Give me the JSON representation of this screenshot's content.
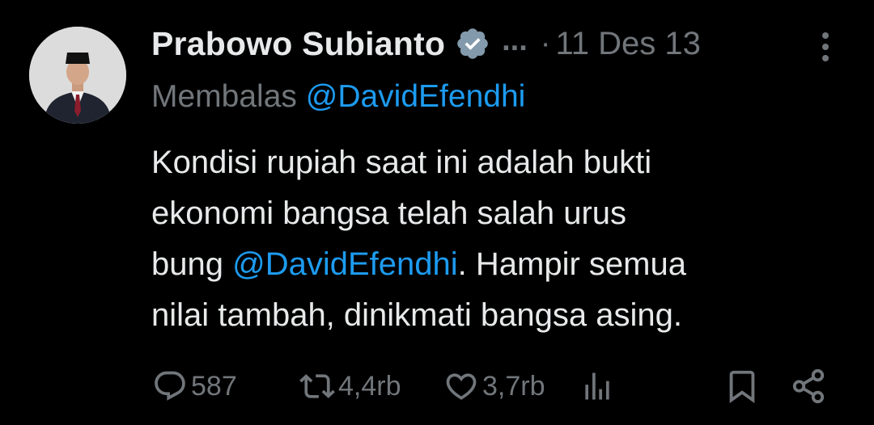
{
  "author": {
    "name": "Prabowo Subianto",
    "ellipsis": "...",
    "separator": "·",
    "date": "11 Des 13"
  },
  "reply": {
    "prefix": "Membalas ",
    "mention": "@DavidEfendhi"
  },
  "tweet": {
    "line1": "Kondisi rupiah saat ini adalah bukti",
    "line2": "ekonomi bangsa telah salah urus",
    "line3_prefix": "bung ",
    "line3_mention": "@DavidEfendhi",
    "line3_suffix": ". Hampir semua",
    "line4": "nilai tambah, dinikmati bangsa asing."
  },
  "actions": {
    "reply_icon": "reply-icon",
    "reply_count": "587",
    "retweet_icon": "retweet-icon",
    "retweet_count": "4,4rb",
    "like_icon": "heart-icon",
    "like_count": "3,7rb",
    "views_icon": "analytics-icon",
    "bookmark_icon": "bookmark-icon",
    "share_icon": "share-icon"
  },
  "colors": {
    "background": "#000000",
    "text": "#e7e9ea",
    "muted": "#71767b",
    "link": "#1d9bf0",
    "verified_badge": "#829aab"
  }
}
